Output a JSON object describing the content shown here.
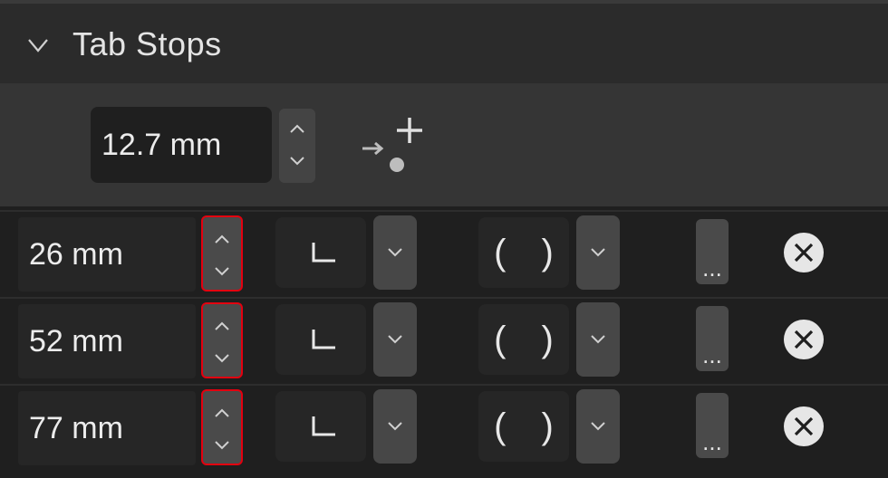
{
  "panel": {
    "title": "Tab Stops",
    "collapse_icon": "chevron-down-icon"
  },
  "default_tab": {
    "value": "12.7 mm",
    "stepper_icons": [
      "chevron-up-icon",
      "chevron-down-icon"
    ],
    "add_tab_icon": "add-tab-stop-icon"
  },
  "tab_stops": [
    {
      "position": "26 mm",
      "alignment_icon": "left-align-tab-icon",
      "leader": "( )"
    },
    {
      "position": "52 mm",
      "alignment_icon": "left-align-tab-icon",
      "leader": "( )"
    },
    {
      "position": "77 mm",
      "alignment_icon": "left-align-tab-icon",
      "leader": "( )"
    }
  ],
  "row_icons": {
    "more": "more-icon",
    "more_glyph": "...",
    "delete": "delete-circle-icon"
  },
  "colors": {
    "background": "#1f1f1f",
    "header": "#2b2b2b",
    "default_row": "#353535",
    "highlight": "#e3000f"
  }
}
